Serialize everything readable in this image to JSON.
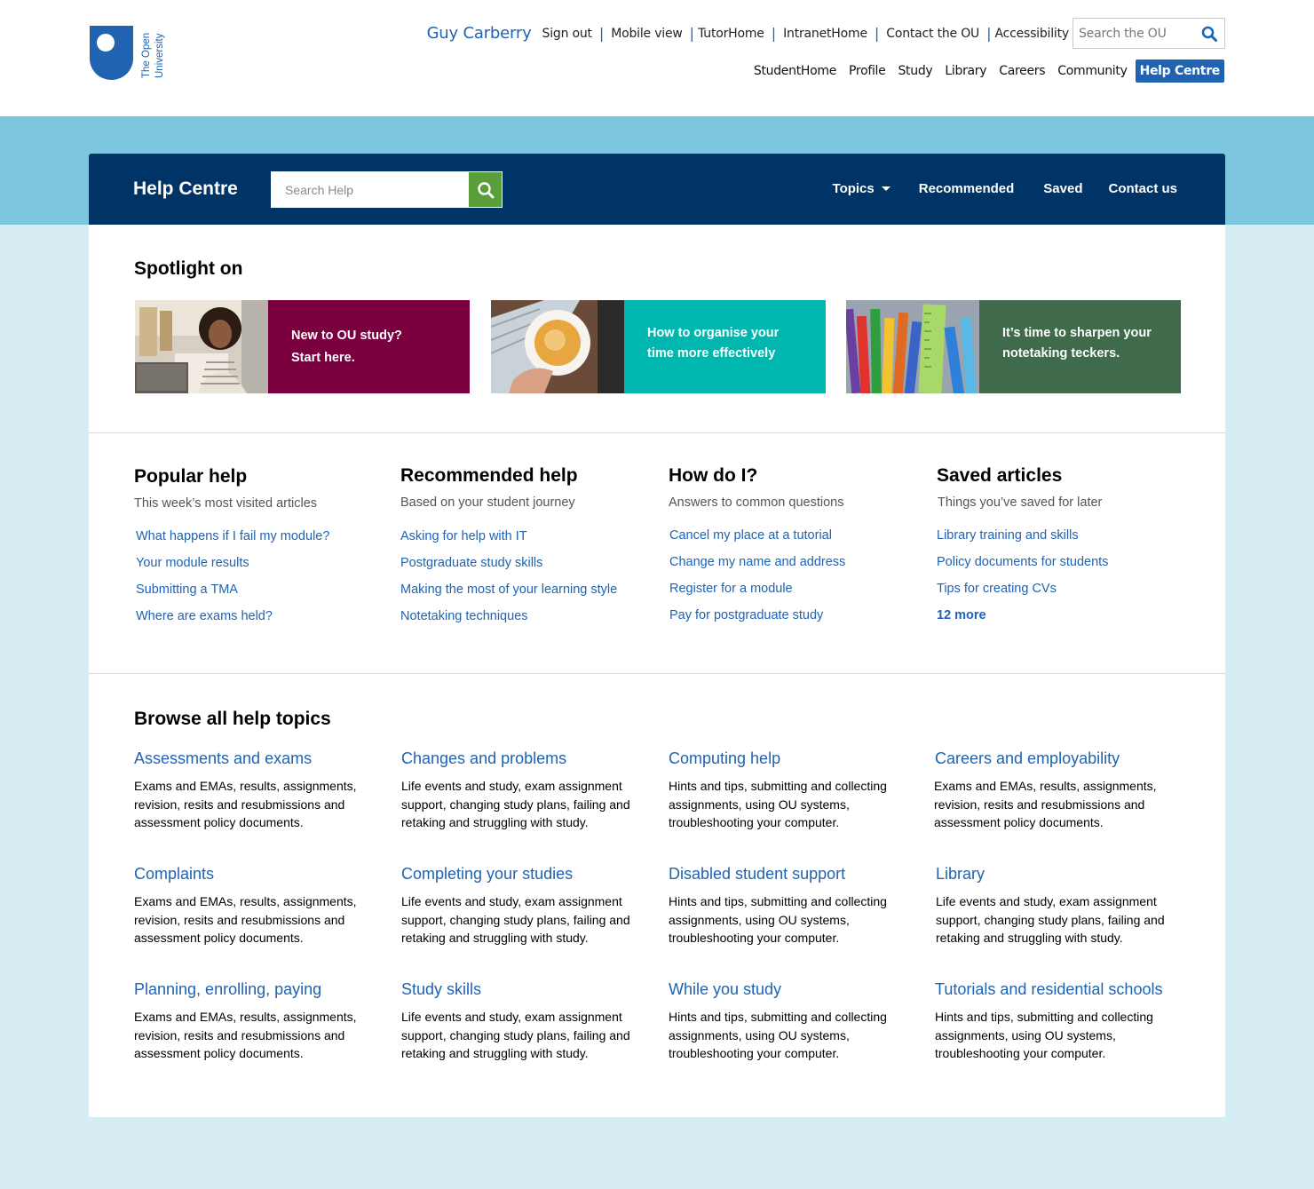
{
  "header": {
    "logo_text": "The Open University",
    "user_name": "Guy Carberry",
    "user_links": [
      "Sign out",
      "Mobile view",
      "TutorHome",
      "IntranetHome",
      "Contact the OU",
      "Accessibility"
    ],
    "search_placeholder": "Search the OU",
    "nav": [
      "StudentHome",
      "Profile",
      "Study",
      "Library",
      "Careers",
      "Community"
    ],
    "nav_active": "Help Centre"
  },
  "help_bar": {
    "title": "Help Centre",
    "search_placeholder": "Search Help",
    "topics_label": "Topics",
    "recommended_label": "Recommended",
    "saved_label": "Saved",
    "contact_label": "Contact us"
  },
  "spotlight": {
    "title": "Spotlight on",
    "cards": [
      {
        "line1": "New to OU study?",
        "line2": "Start here.",
        "color": "#7a0040"
      },
      {
        "line1": "How to organise your",
        "line2": "time more effectively",
        "color": "#00b7b0"
      },
      {
        "line1": "It’s time to sharpen your",
        "line2": "notetaking teckers.",
        "color": "#3f6a4c"
      }
    ]
  },
  "columns": [
    {
      "title": "Popular help",
      "subtitle": "This week’s most visited articles",
      "links": [
        "What happens if I fail my module?",
        "Your module results",
        "Submitting a TMA",
        "Where are exams held?"
      ]
    },
    {
      "title": "Recommended help",
      "subtitle": "Based on your student journey",
      "links": [
        "Asking for help with IT",
        "Postgraduate study skills",
        "Making the most of your learning style",
        "Notetaking techniques"
      ]
    },
    {
      "title": "How do I?",
      "subtitle": "Answers to common questions",
      "links": [
        "Cancel my place at a tutorial",
        "Change my name and address",
        "Register for a module",
        "Pay for postgraduate study"
      ]
    },
    {
      "title": "Saved articles",
      "subtitle": "Things you’ve saved for later",
      "links": [
        "Library training and skills",
        "Policy documents for students",
        "Tips for creating CVs",
        "12 more"
      ]
    }
  ],
  "browse": {
    "title": "Browse all help topics",
    "topics": [
      {
        "title": "Assessments and exams",
        "desc": "Exams and EMAs, results, assignments, revision, resits and resubmissions and assessment policy documents."
      },
      {
        "title": "Changes and problems",
        "desc": "Life events and study, exam assignment support, changing study plans, failing and retaking and struggling with study."
      },
      {
        "title": "Computing help",
        "desc": "Hints and tips, submitting and collecting assignments, using OU systems, troubleshooting your computer."
      },
      {
        "title": "Careers and employability",
        "desc": "Exams and EMAs, results, assignments, revision, resits and resubmissions and assessment policy documents."
      },
      {
        "title": "Complaints",
        "desc": "Exams and EMAs, results, assignments, revision, resits and resubmissions and assessment policy documents."
      },
      {
        "title": "Completing your studies",
        "desc": "Life events and study, exam assignment support, changing study plans, failing and retaking and struggling with study."
      },
      {
        "title": "Disabled student support",
        "desc": "Hints and tips, submitting and collecting assignments, using OU systems, troubleshooting your computer."
      },
      {
        "title": "Library",
        "desc": "Life events and study, exam assignment support, changing study plans, failing and retaking and struggling with study."
      },
      {
        "title": "Planning, enrolling, paying",
        "desc": "Exams and EMAs, results, assignments, revision, resits and resubmissions and assessment policy documents."
      },
      {
        "title": "Study skills",
        "desc": "Life events and study, exam assignment support, changing study plans, failing and retaking and struggling with study."
      },
      {
        "title": "While you study",
        "desc": "Hints and tips, submitting and collecting assignments, using OU systems, troubleshooting your computer."
      },
      {
        "title": "Tutorials and residential schools",
        "desc": "Hints and tips, submitting and collecting assignments, using OU systems, troubleshooting your computer."
      }
    ]
  }
}
